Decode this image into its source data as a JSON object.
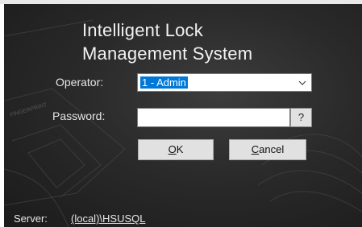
{
  "window": {
    "title_line1": "Intelligent Lock",
    "title_line2": "Management System"
  },
  "form": {
    "operator_label": "Operator:",
    "operator_value": "1 - Admin",
    "password_label": "Password:",
    "password_value": "",
    "help_label": "?",
    "ok_label": "OK",
    "ok_mnemonic": "O",
    "ok_rest": "K",
    "cancel_label": "Cancel",
    "cancel_mnemonic": "C",
    "cancel_rest": "ancel"
  },
  "footer": {
    "server_label": "Server:",
    "server_value": "(local)\\HSUSQL"
  },
  "icons": {
    "dropdown": "chevron-down-icon",
    "background": "fingerprint-texture"
  },
  "colors": {
    "panel_background": "#2a2a2a",
    "text": "#e6e6e6",
    "selection": "#0078d7",
    "button_face": "#e1e1e1"
  }
}
